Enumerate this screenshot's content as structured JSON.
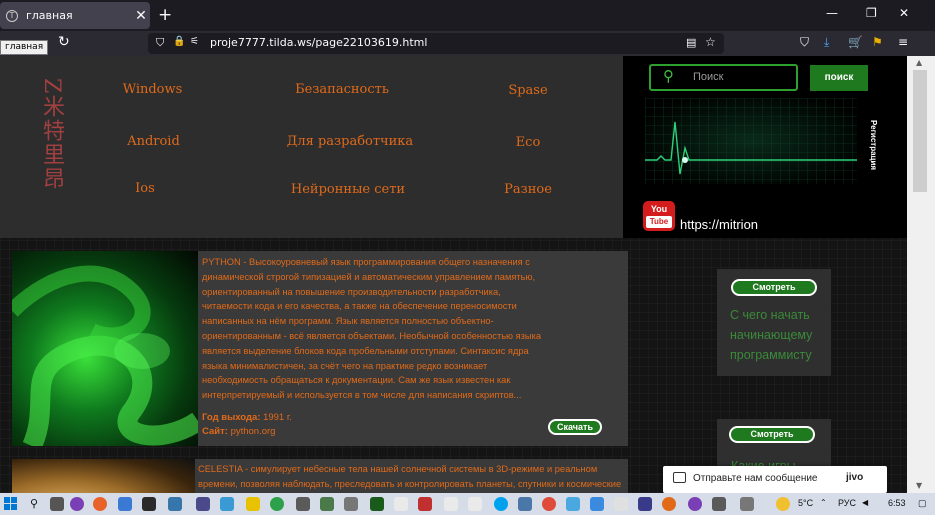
{
  "browser": {
    "tab_title": "главная",
    "tab_close": "✕",
    "new_tab": "+",
    "tooltip": "главная",
    "url": "proje7777.tilda.ws/page22103619.html",
    "win_min": "—",
    "win_restore": "❐",
    "win_close": "✕"
  },
  "menu": {
    "brand": "Z米特里昂",
    "items": [
      "Windows",
      "Безапасность",
      "Spase",
      "Android",
      "Для разработчика",
      "Eco",
      "Ios",
      "Нейронные сети",
      "Разное"
    ]
  },
  "search": {
    "placeholder": "Поиск",
    "button_label": "поиск"
  },
  "registration_label": "Регистрация",
  "youtube": {
    "you": "You",
    "tube": "Tube",
    "url": "https://mitrion"
  },
  "card_python": {
    "description": "PYTHON - Высокоуровневый язык программирования общего назначения с динамической строгой типизацией и автоматическим управлением памятью, ориентированный на повышение производительности разработчика, читаемости кода и его качества, а также на обеспечение переносимости написанных на нём программ. Язык является полностью объектно-ориентированным - всё является объектами. Необычной особенностью языка является выделение блоков кода пробельными отступами. Синтаксис ядра языка минималистичен, за счёт чего на практике редко возникает необходимость обращаться к документации. Сам же язык известен как интерпретируемый и используется в том числе для написания скриптов...",
    "year_label": "Год выхода:",
    "year_value": "1991 г.",
    "site_label": "Сайт:",
    "site_value": "python.org",
    "download_label": "Скачать"
  },
  "card_celestia": {
    "description": "CELESTIA - симулирует небесные тела нашей солнечной системы в 3D-режиме и реальном времени, позволяя наблюдать, преследовать и контролировать планеты, спутники и космические станции во"
  },
  "side_cards": [
    {
      "button_label": "Смотреть",
      "title": "С чего начать начинающему программисту"
    },
    {
      "button_label": "Смотреть",
      "title": "Какие игры"
    }
  ],
  "chat": {
    "text": "Отправьте нам сообщение",
    "brand": "jivo"
  },
  "taskbar": {
    "weather": "5°C",
    "language": "РУС",
    "time": "6:53"
  }
}
